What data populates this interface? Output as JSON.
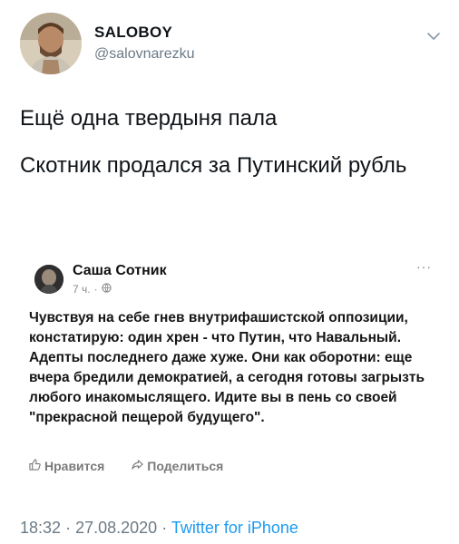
{
  "tweet": {
    "display_name": "SALOBOY",
    "handle": "@salovnarezku",
    "paragraphs": [
      "Ещё одна твердыня пала",
      "Скотник продался за Путинский рубль"
    ],
    "time": "18:32",
    "date": "27.08.2020",
    "separator": "·",
    "source": "Twitter for iPhone",
    "icons": {
      "avatar": "user-avatar",
      "menu": "chevron-down-icon"
    }
  },
  "embed": {
    "name": "Саша Сотник",
    "time": "7 ч.",
    "separator": "·",
    "more": "···",
    "text": "Чувствуя на себе гнев внутрифашистской оппозиции, констатирую: один хрен - что Путин, что Навальный. Адепты последнего даже хуже. Они как оборотни: еще вчера бредили демократией, а сегодня готовы загрызть любого инакомыслящего. Идите вы в пень со своей \"прекрасной пещерой будущего\".",
    "like_label": "Нравится",
    "share_label": "Поделиться",
    "icons": {
      "privacy": "globe-icon",
      "like": "thumbs-up-icon",
      "share": "share-arrow-icon"
    }
  }
}
